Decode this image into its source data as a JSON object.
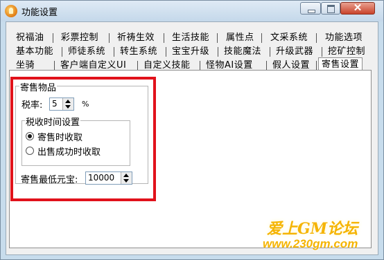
{
  "window": {
    "title": "功能设置",
    "close_glyph": "✕"
  },
  "tabs": {
    "row1": [
      "祝福油",
      "彩票控制",
      "祈祷生效",
      "生活技能",
      "属性点",
      "文采系统",
      "功能选项"
    ],
    "row2": [
      "基本功能",
      "师徒系统",
      "转生系统",
      "宝宝升级",
      "技能魔法",
      "升级武器",
      "挖矿控制"
    ],
    "row3": [
      "坐骑",
      "客户端自定义UI",
      "自定义技能",
      "怪物AI设置",
      "假人设置",
      "寄售设置"
    ],
    "active": "寄售设置"
  },
  "consign": {
    "group_title": "寄售物品",
    "tax_label": "税率:",
    "tax_value": "5",
    "tax_unit": "%",
    "time_group_title": "税收时间设置",
    "option_on_consign": "寄售时收取",
    "option_on_sold": "出售成功时收取",
    "selected_option": "寄售时收取",
    "min_price_label": "寄售最低元宝:",
    "min_price_value": "10000"
  },
  "watermark": {
    "text": "爱上GM论坛",
    "url": "www.230gm.com"
  },
  "colors": {
    "highlight_frame": "#e1121b",
    "watermark": "#f5b400"
  },
  "icons": {
    "app": "app-flame-icon",
    "minimize": "minimize-icon",
    "maximize": "maximize-icon",
    "close": "close-icon",
    "spin_up": "spin-up-arrow-icon",
    "spin_down": "spin-down-arrow-icon"
  }
}
